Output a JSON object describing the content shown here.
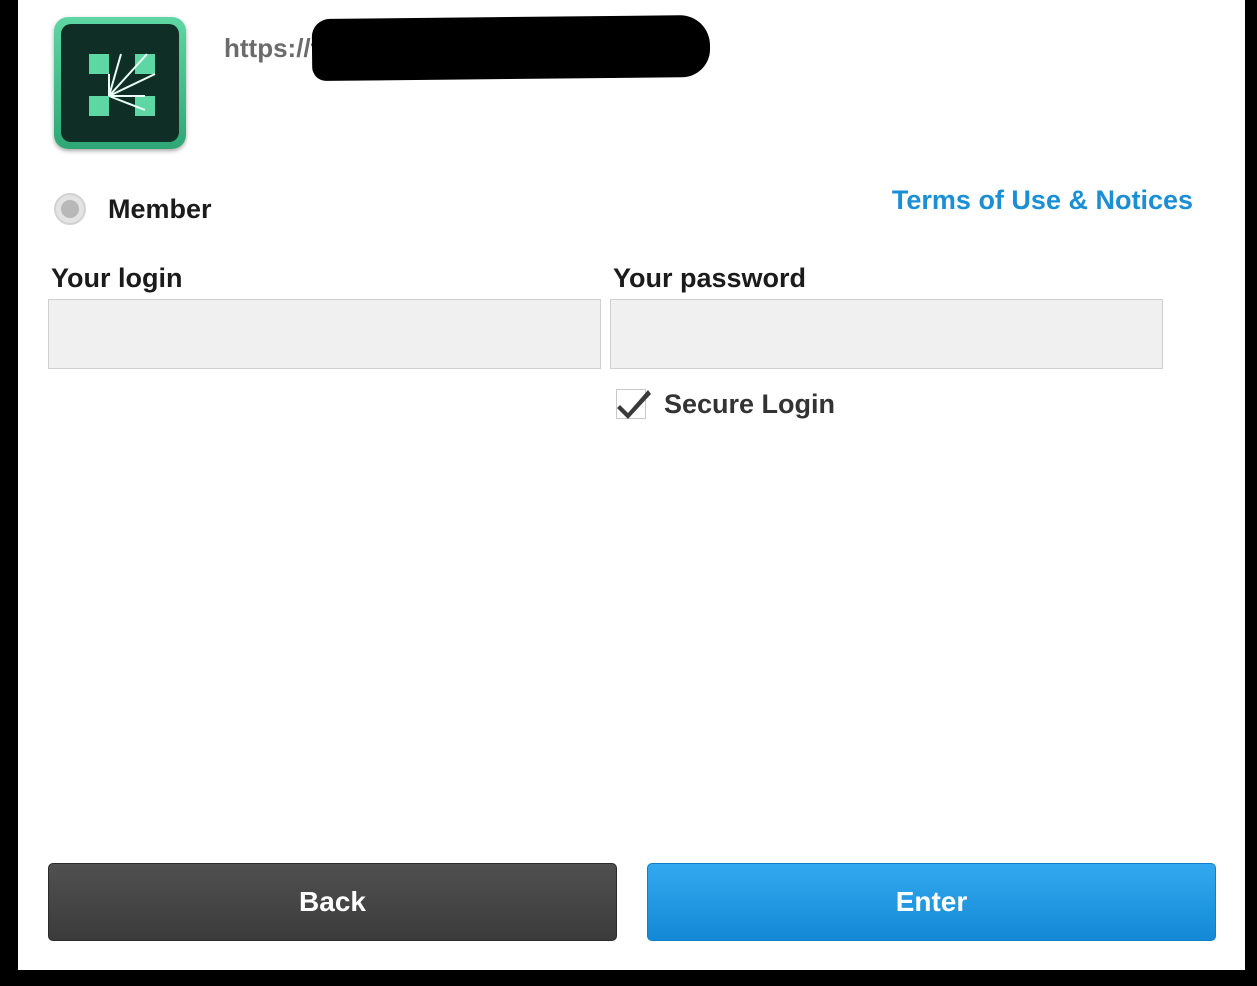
{
  "header": {
    "app_icon": "adobe-connect-icon",
    "url_visible": "https://te",
    "url_redacted": true
  },
  "role": {
    "option_label": "Member",
    "selected": false
  },
  "links": {
    "terms": "Terms of Use & Notices"
  },
  "form": {
    "login_label": "Your login",
    "login_value": "",
    "password_label": "Your password",
    "password_value": "",
    "secure_login_label": "Secure Login",
    "secure_login_checked": true
  },
  "buttons": {
    "back": "Back",
    "enter": "Enter"
  },
  "colors": {
    "link": "#1a8fd6",
    "enter_button": "#1a93dd",
    "back_button": "#444444",
    "icon_green": "#3cbf89",
    "icon_dark": "#0f2f26"
  }
}
